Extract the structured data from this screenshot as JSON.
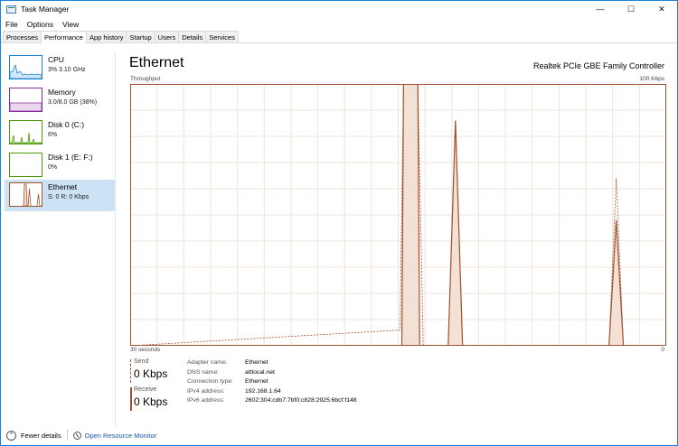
{
  "window": {
    "title": "Task Manager"
  },
  "menu": [
    "File",
    "Options",
    "View"
  ],
  "tabs": [
    "Processes",
    "Performance",
    "App history",
    "Startup",
    "Users",
    "Details",
    "Services"
  ],
  "sidebar": {
    "items": [
      {
        "name": "CPU",
        "sub": "3% 3.10 GHz",
        "color": "#1783d4"
      },
      {
        "name": "Memory",
        "sub": "3.0/8.0 GB (38%)",
        "color": "#8b2f9c"
      },
      {
        "name": "Disk 0 (C:)",
        "sub": "6%",
        "color": "#4d9a06"
      },
      {
        "name": "Disk 1 (E: F:)",
        "sub": "0%",
        "color": "#4d9a06"
      },
      {
        "name": "Ethernet",
        "sub": "S: 0 R: 0 Kbps",
        "color": "#a0522d"
      }
    ],
    "selected": "Ethernet"
  },
  "main": {
    "title": "Ethernet",
    "adapter": "Realtek PCIe GBE Family Controller",
    "throughput_label": "Throughput",
    "max_label": "100 Kbps",
    "time_label": "30 seconds",
    "min_label": "0"
  },
  "chart_data": {
    "type": "area",
    "title": "",
    "ylabel": "Throughput",
    "ylim": [
      0,
      100
    ],
    "x": [
      0,
      30
    ],
    "grid": true,
    "series": [
      {
        "name": "Receive",
        "style": "solid",
        "color": "#a0522d",
        "points": [
          [
            0,
            0
          ],
          [
            15.2,
            0
          ],
          [
            15.3,
            100
          ],
          [
            16.1,
            100
          ],
          [
            16.2,
            0
          ],
          [
            17.8,
            0
          ],
          [
            18.2,
            86
          ],
          [
            18.6,
            0
          ],
          [
            26.8,
            0
          ],
          [
            27.2,
            48
          ],
          [
            27.6,
            0
          ],
          [
            30,
            0
          ]
        ]
      },
      {
        "name": "Send",
        "style": "dashed",
        "color": "#a0522d",
        "points": [
          [
            0,
            0
          ],
          [
            15.1,
            6
          ],
          [
            15.3,
            100
          ],
          [
            16.1,
            100
          ],
          [
            16.4,
            0
          ],
          [
            17.8,
            0
          ],
          [
            18.2,
            86
          ],
          [
            18.6,
            0
          ],
          [
            26.8,
            0
          ],
          [
            27.2,
            64
          ],
          [
            27.6,
            0
          ],
          [
            30,
            0
          ]
        ]
      }
    ],
    "colors": {
      "line": "#a0522d",
      "fill": "#f3e1d6",
      "grid": "#efe3dc",
      "border": "#a0522d"
    }
  },
  "stats": {
    "send": {
      "label": "Send",
      "value": "0 Kbps"
    },
    "receive": {
      "label": "Receive",
      "value": "0 Kbps"
    }
  },
  "properties": [
    {
      "key": "Adapter name:",
      "value": "Ethernet"
    },
    {
      "key": "DNS name:",
      "value": "attlocal.net"
    },
    {
      "key": "Connection type:",
      "value": "Ethernet"
    },
    {
      "key": "IPv4 address:",
      "value": "192.168.1.64"
    },
    {
      "key": "IPv6 address:",
      "value": "2602:304:cdb7:7bf0:c828:2925:6bcf:f148"
    }
  ],
  "footer": {
    "fewer_details": "Fewer details",
    "resource_monitor": "Open Resource Monitor"
  }
}
